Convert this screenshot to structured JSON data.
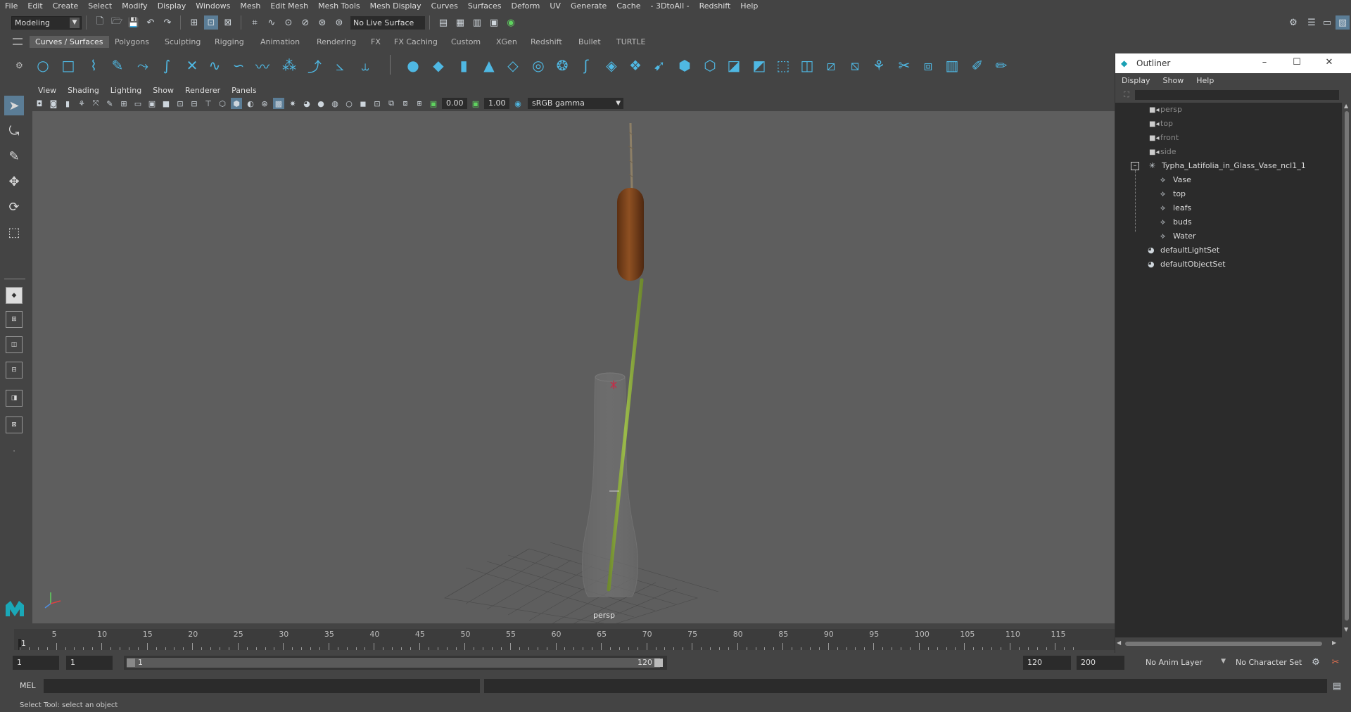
{
  "menubar": {
    "items": [
      "File",
      "Edit",
      "Create",
      "Select",
      "Modify",
      "Display",
      "Windows",
      "Mesh",
      "Edit Mesh",
      "Mesh Tools",
      "Mesh Display",
      "Curves",
      "Surfaces",
      "Deform",
      "UV",
      "Generate",
      "Cache",
      "- 3DtoAll -",
      "Redshift",
      "Help"
    ]
  },
  "statusline": {
    "mode": "Modeling",
    "live_surface": "No Live Surface"
  },
  "shelf": {
    "tabs": [
      "Curves / Surfaces",
      "Polygons",
      "Sculpting",
      "Rigging",
      "Animation",
      "Rendering",
      "FX",
      "FX Caching",
      "Custom",
      "XGen",
      "Redshift",
      "Bullet",
      "TURTLE"
    ],
    "active_tab": "Curves / Surfaces"
  },
  "panel": {
    "menu": [
      "View",
      "Shading",
      "Lighting",
      "Show",
      "Renderer",
      "Panels"
    ],
    "exposure": "0.00",
    "gamma": "1.00",
    "color_space": "sRGB gamma",
    "camera_label": "persp"
  },
  "outliner": {
    "title": "Outliner",
    "menu": [
      "Display",
      "Show",
      "Help"
    ],
    "items": [
      {
        "label": "persp",
        "icon": "camera-icon",
        "dim": true
      },
      {
        "label": "top",
        "icon": "camera-icon",
        "dim": true
      },
      {
        "label": "front",
        "icon": "camera-icon",
        "dim": true
      },
      {
        "label": "side",
        "icon": "camera-icon",
        "dim": true
      },
      {
        "label": "Typha_Latifolia_in_Glass_Vase_ncl1_1",
        "icon": "group-icon",
        "dim": false
      },
      {
        "label": "Vase",
        "icon": "mesh-icon",
        "dim": false
      },
      {
        "label": "top",
        "icon": "mesh-icon",
        "dim": false
      },
      {
        "label": "leafs",
        "icon": "mesh-icon",
        "dim": false
      },
      {
        "label": "buds",
        "icon": "mesh-icon",
        "dim": false
      },
      {
        "label": "Water",
        "icon": "mesh-icon",
        "dim": false
      },
      {
        "label": "defaultLightSet",
        "icon": "set-icon",
        "dim": false
      },
      {
        "label": "defaultObjectSet",
        "icon": "set-icon",
        "dim": false
      }
    ]
  },
  "timeline": {
    "ticks": [
      "1",
      "5",
      "10",
      "15",
      "20",
      "25",
      "30",
      "35",
      "40",
      "45",
      "50",
      "55",
      "60",
      "65",
      "70",
      "75",
      "80",
      "85",
      "90",
      "95",
      "100",
      "105",
      "110",
      "115"
    ],
    "range_start": "1",
    "playback_start": "1",
    "range_slider_start": "1",
    "range_slider_end": "120",
    "playback_end": "120",
    "range_end": "200",
    "anim_layer": "No Anim Layer",
    "character_set": "No Character Set"
  },
  "cmdline": {
    "label": "MEL"
  },
  "helpline": {
    "text": "Select Tool: select an object"
  }
}
